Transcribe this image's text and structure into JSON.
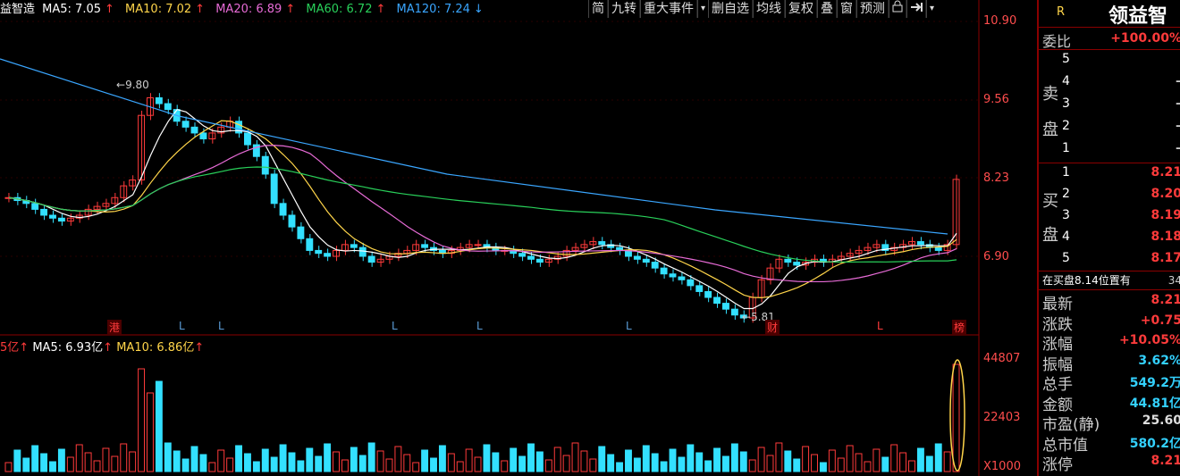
{
  "title_stock": "益智造",
  "ma_line": [
    {
      "label": "MA5: 7.05",
      "arrow": "↑",
      "color": "#ffffff"
    },
    {
      "label": "MA10: 7.02",
      "arrow": "↑",
      "color": "#ffd54a"
    },
    {
      "label": "MA20: 6.89",
      "arrow": "↑",
      "color": "#e76bd6"
    },
    {
      "label": "MA60: 6.72",
      "arrow": "↑",
      "color": "#29d05a"
    },
    {
      "label": "MA120: 7.24",
      "arrow": "↓",
      "color": "#3aa6ff"
    }
  ],
  "toolbar": [
    "简",
    "九转",
    "重大事件",
    "删自选",
    "均线",
    "复权",
    "叠",
    "窗",
    "预测"
  ],
  "toolbar_arrow": "▾",
  "right_axis_price": [
    "10.90",
    "9.56",
    "8.23",
    "6.90"
  ],
  "right_axis_vol": [
    "44807",
    "22403",
    "X1000"
  ],
  "annotations": {
    "high": "9.80",
    "low": "5.81"
  },
  "markers": [
    "港",
    "L",
    "L",
    "L",
    "L",
    "L",
    "财",
    "L",
    "榜"
  ],
  "vol_header": {
    "prefix": "5亿",
    "arrow1": "↑",
    "ma5": "MA5: 6.93亿",
    "arrow2": "↑",
    "ma10": "MA10: 6.86亿",
    "arrow3": "↑"
  },
  "panel": {
    "r": "R",
    "name": "领益智",
    "ratio_label": "委比",
    "ratio_val": "+100.00%",
    "sell_label": "卖盘",
    "buy_label": "买盘",
    "sell": [
      {
        "n": "5",
        "v": ""
      },
      {
        "n": "4",
        "v": "–"
      },
      {
        "n": "3",
        "v": "–"
      },
      {
        "n": "2",
        "v": "–"
      },
      {
        "n": "1",
        "v": "–"
      }
    ],
    "buy": [
      {
        "n": "1",
        "v": "8.21"
      },
      {
        "n": "2",
        "v": "8.20"
      },
      {
        "n": "3",
        "v": "8.19"
      },
      {
        "n": "4",
        "v": "8.18"
      },
      {
        "n": "5",
        "v": "8.17"
      }
    ],
    "note": "在买盘8.14位置有",
    "note_num": "34",
    "stats": [
      {
        "k": "最新",
        "v": "8.21",
        "c": "#ff3b3b"
      },
      {
        "k": "涨跌",
        "v": "+0.75",
        "c": "#ff3b3b"
      },
      {
        "k": "涨幅",
        "v": "+10.05%",
        "c": "#ff3b3b"
      },
      {
        "k": "振幅",
        "v": "3.62%",
        "c": "#33d1ff"
      },
      {
        "k": "总手",
        "v": "549.2万",
        "c": "#33d1ff"
      },
      {
        "k": "金额",
        "v": "44.81亿",
        "c": "#33d1ff"
      },
      {
        "k": "市盈(静)",
        "v": "25.60",
        "c": "#dddddd"
      },
      {
        "k": "总市值",
        "v": "580.2亿",
        "c": "#33d1ff"
      },
      {
        "k": "涨停",
        "v": "8.21",
        "c": "#ff3b3b"
      }
    ]
  }
}
